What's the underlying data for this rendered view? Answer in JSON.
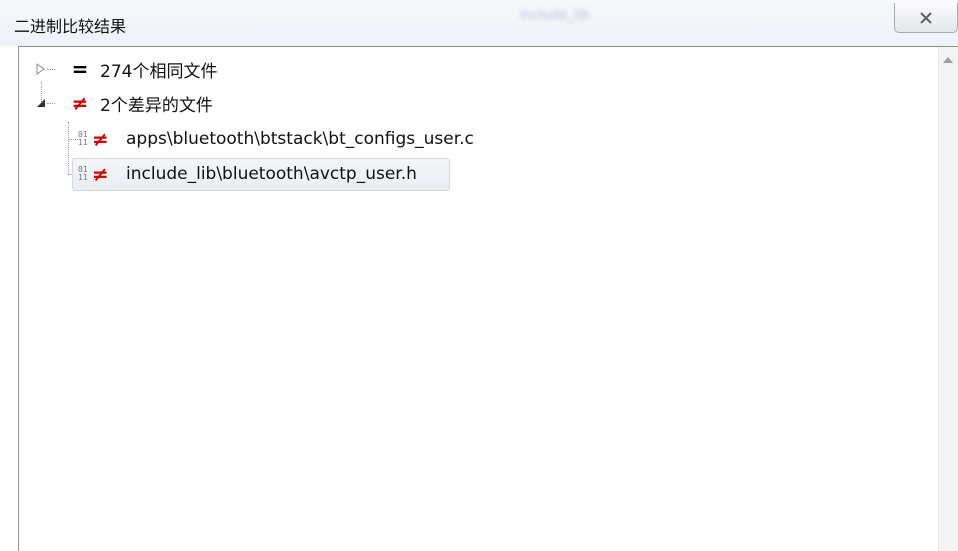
{
  "window": {
    "title": "二进制比较结果",
    "blurred_caption": "include_lib",
    "close_icon": "close-icon"
  },
  "tree": {
    "nodes": [
      {
        "symbol": "=",
        "label": "274个相同文件",
        "expanded": false,
        "symbol_color": "#000000"
      },
      {
        "symbol": "≠",
        "label": "2个差异的文件",
        "expanded": true,
        "symbol_color": "#d40000",
        "children": [
          {
            "symbol": "≠",
            "label": "apps\\bluetooth\\btstack\\bt_configs_user.c",
            "selected": false
          },
          {
            "symbol": "≠",
            "label": "include_lib\\bluetooth\\avctp_user.h",
            "selected": true
          }
        ]
      }
    ]
  },
  "colors": {
    "diff": "#d40000",
    "selection": "#e9edf2"
  }
}
